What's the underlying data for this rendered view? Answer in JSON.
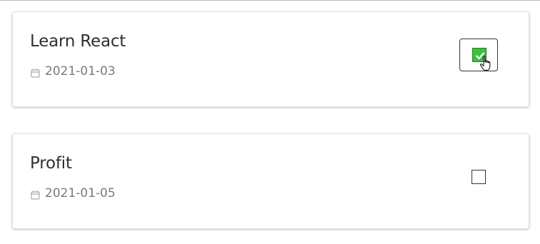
{
  "todos": [
    {
      "title": "Learn React",
      "date": "2021-01-03",
      "checked": true
    },
    {
      "title": "Profit",
      "date": "2021-01-05",
      "checked": false
    }
  ],
  "icons": {
    "date": "calendar-icon",
    "checkmark": "check-icon",
    "cursor": "hand-pointer-icon"
  },
  "colors": {
    "checked_fill": "#3fbf3f",
    "title_text": "#2f2f2f",
    "date_text": "#7a7a7a"
  }
}
